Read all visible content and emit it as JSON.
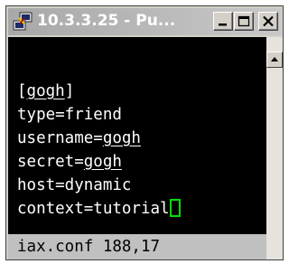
{
  "window": {
    "title": "10.3.3.25 - Pu...",
    "icon": "putty-icon",
    "controls": {
      "minimize_icon": "minimize-icon",
      "maximize_icon": "maximize-icon",
      "close_icon": "close-icon"
    }
  },
  "terminal": {
    "lines": [
      {
        "prefix": "[",
        "underlined": "gogh",
        "suffix": "]"
      },
      {
        "text": "type=friend"
      },
      {
        "prefix": "username=",
        "underlined": "gogh"
      },
      {
        "prefix": "secret=",
        "underlined": "gogh"
      },
      {
        "text": "host=dynamic"
      },
      {
        "text": "context=tutorial"
      }
    ],
    "status": "iax.conf 188,17",
    "colors": {
      "background": "#000000",
      "text": "#ffffff",
      "cursor": "#00e000",
      "status_bg": "#c0c0c0"
    }
  },
  "scrollbar": {
    "up_icon": "scroll-up-arrow-icon"
  }
}
